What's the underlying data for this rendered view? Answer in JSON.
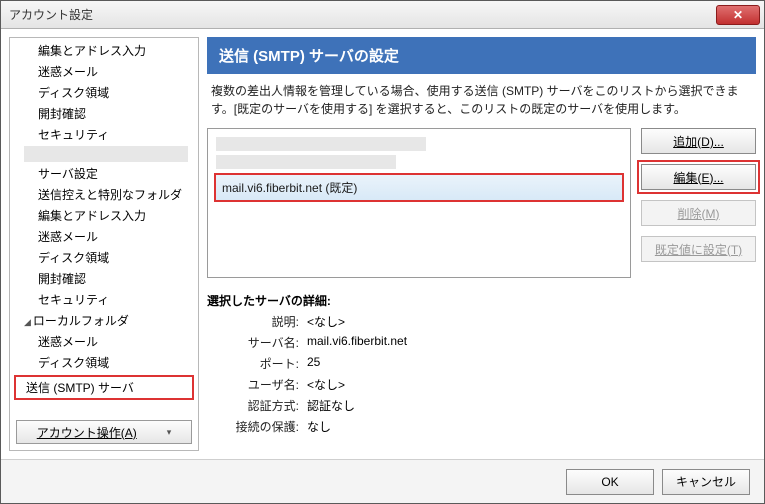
{
  "window": {
    "title": "アカウント設定"
  },
  "sidebar": {
    "items": [
      "編集とアドレス入力",
      "迷惑メール",
      "ディスク領域",
      "開封確認",
      "セキュリティ",
      "サーバ設定",
      "送信控えと特別なフォルダ",
      "編集とアドレス入力",
      "迷惑メール",
      "ディスク領域",
      "開封確認",
      "セキュリティ"
    ],
    "local_folder": "ローカルフォルダ",
    "local_children": [
      "迷惑メール",
      "ディスク領域"
    ],
    "smtp_label": "送信 (SMTP) サーバ",
    "account_ops": "アカウント操作(A)"
  },
  "main": {
    "header": "送信 (SMTP) サーバの設定",
    "desc": "複数の差出人情報を管理している場合、使用する送信 (SMTP) サーバをこのリストから選択できます。[既定のサーバを使用する] を選択すると、このリストの既定のサーバを使用します。",
    "selected_server": "mail.vi6.fiberbit.net (既定)",
    "buttons": {
      "add": "追加(D)...",
      "edit": "編集(E)...",
      "delete": "削除(M)",
      "default": "既定値に設定(T)"
    },
    "detail_title": "選択したサーバの詳細:",
    "details": {
      "desc_label": "説明:",
      "desc_value": "<なし>",
      "server_label": "サーバ名:",
      "server_value": "mail.vi6.fiberbit.net",
      "port_label": "ポート:",
      "port_value": "25",
      "user_label": "ユーザ名:",
      "user_value": "<なし>",
      "auth_label": "認証方式:",
      "auth_value": "認証なし",
      "sec_label": "接続の保護:",
      "sec_value": "なし"
    }
  },
  "footer": {
    "ok": "OK",
    "cancel": "キャンセル"
  }
}
